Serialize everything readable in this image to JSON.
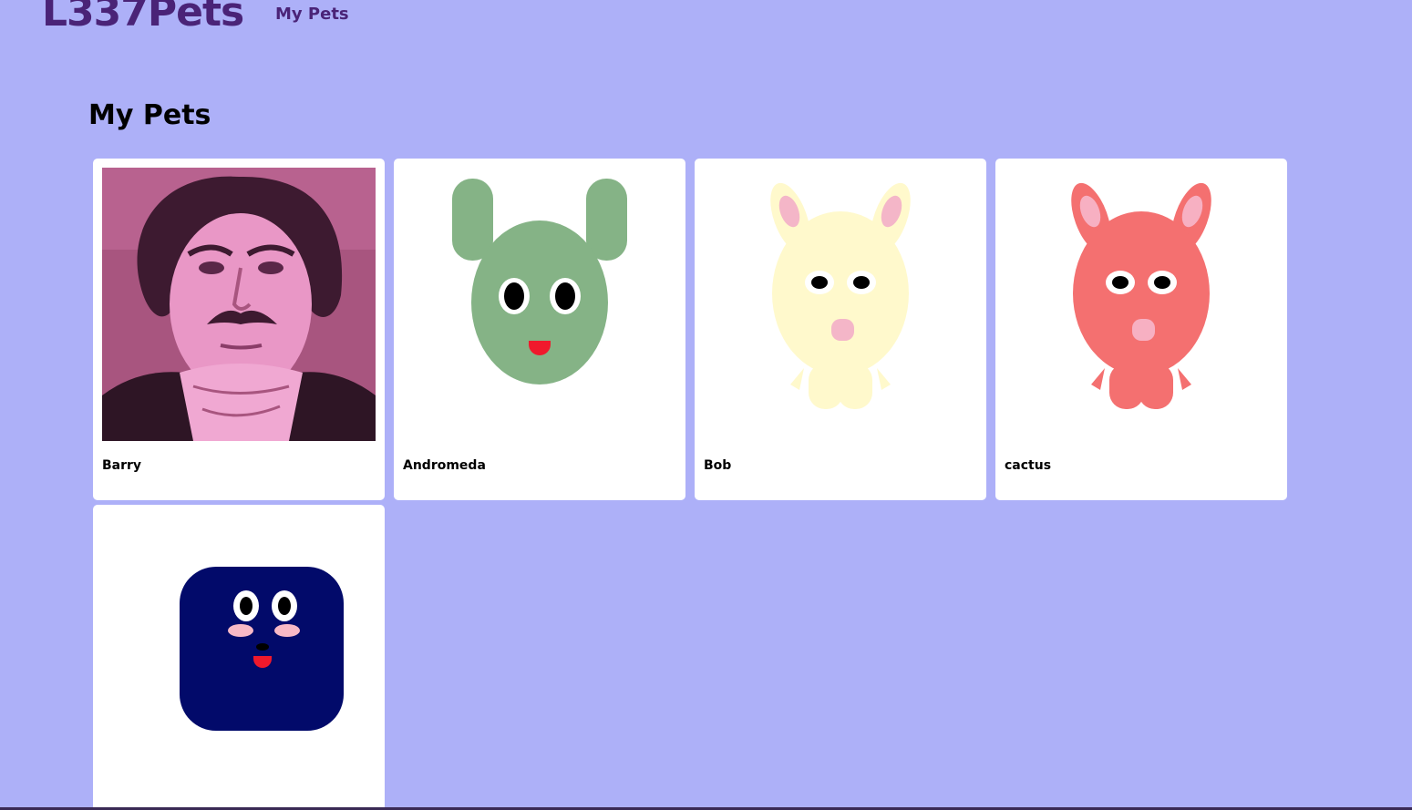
{
  "colors": {
    "background": "#adb0f8",
    "brand": "#4a2377",
    "card": "#ffffff",
    "text": "#000000"
  },
  "header": {
    "logo": "L337Pets",
    "nav": {
      "my_pets": "My Pets"
    }
  },
  "main": {
    "title": "My Pets",
    "pets": [
      {
        "name": "Barry",
        "avatar": "portrait-photo"
      },
      {
        "name": "Andromeda",
        "avatar": "green-mouse-creature"
      },
      {
        "name": "Bob",
        "avatar": "cream-bunny-creature"
      },
      {
        "name": "cactus",
        "avatar": "coral-bunny-creature"
      },
      {
        "name": "",
        "avatar": "navy-square-creature"
      }
    ]
  }
}
